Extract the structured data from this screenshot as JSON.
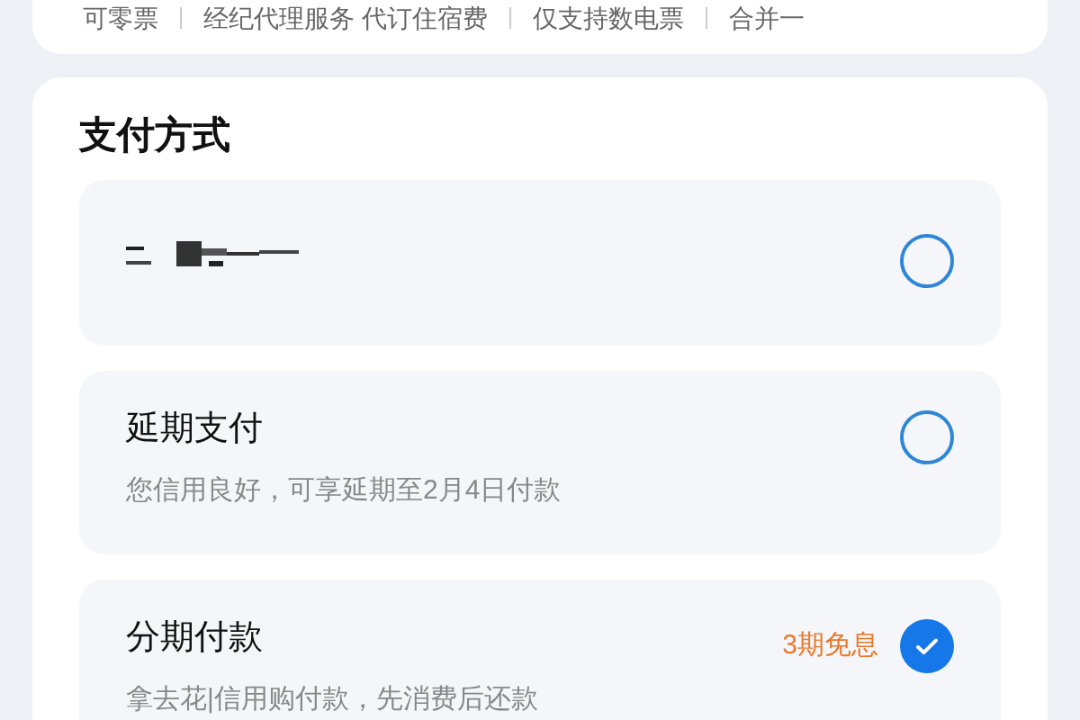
{
  "invoice_tags": [
    "可零票",
    "经纪代理服务 代订住宿费",
    "仅支持数电票",
    "合并一"
  ],
  "payment": {
    "title": "支付方式",
    "options": [
      {
        "kind": "redacted",
        "selected": false
      },
      {
        "kind": "text",
        "label": "延期支付",
        "description": "您信用良好，可享延期至2月4日付款",
        "selected": false
      },
      {
        "kind": "text",
        "label": "分期付款",
        "badge": "3期免息",
        "description": "拿去花|信用购付款，先消费后还款",
        "selected": true
      }
    ]
  }
}
